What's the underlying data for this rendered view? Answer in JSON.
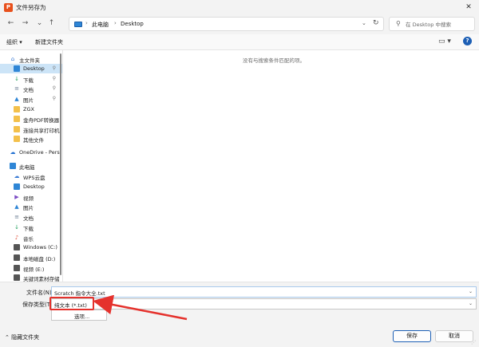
{
  "window": {
    "title": "文件另存为",
    "app_icon_glyph": "P",
    "close_glyph": "✕"
  },
  "nav": {
    "back_glyph": "←",
    "forward_glyph": "→",
    "recent_glyph": "⌄",
    "up_glyph": "↑"
  },
  "address": {
    "breadcrumbs": [
      "此电脑",
      "Desktop"
    ],
    "separator": "›",
    "dropdown_glyph": "⌄",
    "refresh_glyph": "↻"
  },
  "search": {
    "placeholder": "在 Desktop 中搜索",
    "icon_glyph": "⚲"
  },
  "toolbar": {
    "organize_label": "组织 ▾",
    "new_folder_label": "新建文件夹",
    "view_glyph": "▭ ▾",
    "help_glyph": "?"
  },
  "sidebar": {
    "items": [
      {
        "label": "主文件夹",
        "icon": "home-icon",
        "glyph": "⌂",
        "color": "#3a7bd5",
        "pinned": false,
        "selected": false,
        "indent": 1
      },
      {
        "label": "Desktop",
        "icon": "desktop-icon",
        "glyph": "",
        "color": "#2f86d6",
        "pinned": true,
        "selected": true,
        "indent": 2
      },
      {
        "label": "下载",
        "icon": "download-icon",
        "glyph": "↓",
        "color": "#1e9e5a",
        "pinned": true,
        "selected": false,
        "indent": 2
      },
      {
        "label": "文档",
        "icon": "document-icon",
        "glyph": "≡",
        "color": "#6b7c93",
        "pinned": true,
        "selected": false,
        "indent": 2
      },
      {
        "label": "图片",
        "icon": "pictures-icon",
        "glyph": "▲",
        "color": "#2f86d6",
        "pinned": true,
        "selected": false,
        "indent": 2
      },
      {
        "label": "ZGX",
        "icon": "folder-icon",
        "glyph": "",
        "color": "#f3c04b",
        "pinned": false,
        "selected": false,
        "indent": 2
      },
      {
        "label": "金舟PDF转换器",
        "icon": "folder-icon",
        "glyph": "",
        "color": "#f3c04b",
        "pinned": false,
        "selected": false,
        "indent": 2
      },
      {
        "label": "连接共享打印机",
        "icon": "folder-icon",
        "glyph": "",
        "color": "#f3c04b",
        "pinned": false,
        "selected": false,
        "indent": 2
      },
      {
        "label": "其他文件",
        "icon": "folder-icon",
        "glyph": "",
        "color": "#f3c04b",
        "pinned": false,
        "selected": false,
        "indent": 2
      },
      {
        "label": "OneDrive - Pers",
        "icon": "cloud-icon",
        "glyph": "☁",
        "color": "#1f6fd1",
        "pinned": false,
        "selected": false,
        "indent": 1
      },
      {
        "label": "此电脑",
        "icon": "computer-icon",
        "glyph": "",
        "color": "#2f86d6",
        "pinned": false,
        "selected": false,
        "indent": 1
      },
      {
        "label": "WPS云盘",
        "icon": "wps-cloud-icon",
        "glyph": "☁",
        "color": "#3a7bd5",
        "pinned": false,
        "selected": false,
        "indent": 2
      },
      {
        "label": "Desktop",
        "icon": "desktop-icon",
        "glyph": "",
        "color": "#2f86d6",
        "pinned": false,
        "selected": false,
        "indent": 2
      },
      {
        "label": "视频",
        "icon": "video-icon",
        "glyph": "▶",
        "color": "#7b4bc4",
        "pinned": false,
        "selected": false,
        "indent": 2
      },
      {
        "label": "图片",
        "icon": "pictures-icon",
        "glyph": "▲",
        "color": "#2f86d6",
        "pinned": false,
        "selected": false,
        "indent": 2
      },
      {
        "label": "文档",
        "icon": "document-icon",
        "glyph": "≡",
        "color": "#6b7c93",
        "pinned": false,
        "selected": false,
        "indent": 2
      },
      {
        "label": "下载",
        "icon": "download-icon",
        "glyph": "↓",
        "color": "#1e9e5a",
        "pinned": false,
        "selected": false,
        "indent": 2
      },
      {
        "label": "音乐",
        "icon": "music-icon",
        "glyph": "♪",
        "color": "#e0513c",
        "pinned": false,
        "selected": false,
        "indent": 2
      },
      {
        "label": "Windows (C:)",
        "icon": "drive-icon",
        "glyph": "",
        "color": "#555555",
        "pinned": false,
        "selected": false,
        "indent": 2
      },
      {
        "label": "本地磁盘 (D:)",
        "icon": "drive-icon",
        "glyph": "",
        "color": "#555555",
        "pinned": false,
        "selected": false,
        "indent": 2
      },
      {
        "label": "视频 (E:)",
        "icon": "drive-icon",
        "glyph": "",
        "color": "#555555",
        "pinned": false,
        "selected": false,
        "indent": 2
      },
      {
        "label": "关键词素材存储",
        "icon": "drive-icon",
        "glyph": "",
        "color": "#555555",
        "pinned": false,
        "selected": false,
        "indent": 2
      }
    ],
    "pin_glyph": "⚲"
  },
  "content": {
    "empty_message": "没有与搜索条件匹配的项。"
  },
  "form": {
    "filename_label": "文件名(N):",
    "filename_value": "Scratch 指令大全.txt",
    "savetype_label": "保存类型(T):",
    "savetype_value": "纯文本 (*.txt)",
    "chevron_glyph": "⌄",
    "options_label": "选项..."
  },
  "footer": {
    "hide_folders_label": "⌃ 隐藏文件夹",
    "save_label": "保存",
    "cancel_label": "取消"
  },
  "annotation": {
    "color": "#e5322d"
  }
}
